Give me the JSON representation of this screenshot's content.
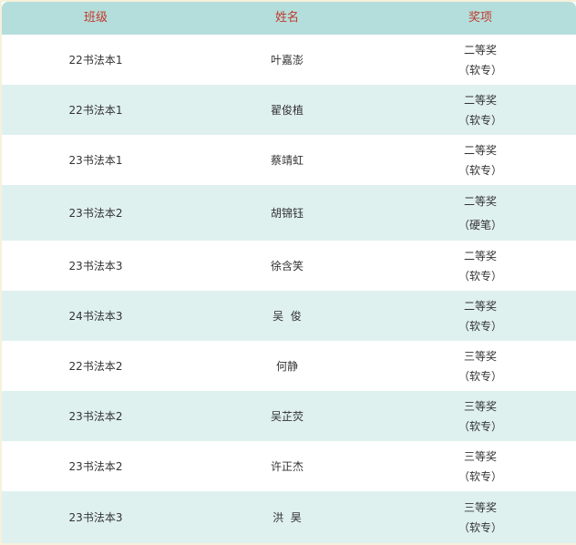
{
  "table": {
    "headers": {
      "class": "班级",
      "name": "姓名",
      "award": "奖项"
    },
    "rows": [
      {
        "class": "22书法本1",
        "name": "叶嘉澎",
        "award": "二等奖",
        "category": "（软专）"
      },
      {
        "class": "22书法本1",
        "name": "翟俊植",
        "award": "二等奖",
        "category": "（软专）"
      },
      {
        "class": "23书法本1",
        "name": "蔡靖虹",
        "award": "二等奖",
        "category": "（软专）"
      },
      {
        "class": "23书法本2",
        "name": "胡锦钰",
        "award": "二等奖",
        "category": "（硬笔）"
      },
      {
        "class": "23书法本3",
        "name": "徐含笑",
        "award": "二等奖",
        "category": "（软专）"
      },
      {
        "class": "24书法本3",
        "name": "吴  俊",
        "award": "二等奖",
        "category": "（软专）"
      },
      {
        "class": "22书法本2",
        "name": "何静",
        "award": "三等奖",
        "category": "（软专）"
      },
      {
        "class": "23书法本2",
        "name": "吴芷荧",
        "award": "三等奖",
        "category": "（软专）"
      },
      {
        "class": "23书法本2",
        "name": "许正杰",
        "award": "三等奖",
        "category": "（软专）"
      },
      {
        "class": "23书法本3",
        "name": "洪  昊",
        "award": "三等奖",
        "category": "（软专）"
      }
    ]
  },
  "colors": {
    "header_bg": "#b4dedb",
    "header_text": "#c0392b",
    "alt_row_bg": "#dff1ef",
    "page_bg": "#f6f1dc"
  }
}
